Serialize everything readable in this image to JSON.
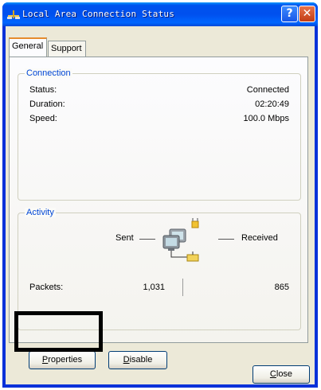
{
  "window": {
    "title": "Local Area Connection Status"
  },
  "title_buttons": {
    "help": "?",
    "close": "✕"
  },
  "tabs": [
    {
      "label": "General",
      "active": true
    },
    {
      "label": "Support",
      "active": false
    }
  ],
  "connection": {
    "group_label": "Connection",
    "rows": [
      {
        "label": "Status:",
        "value": "Connected"
      },
      {
        "label": "Duration:",
        "value": "02:20:49"
      },
      {
        "label": "Speed:",
        "value": "100.0 Mbps"
      }
    ]
  },
  "activity": {
    "group_label": "Activity",
    "sent_label": "Sent",
    "received_label": "Received",
    "packets_label": "Packets:",
    "packets_sent": "1,031",
    "packets_received": "865"
  },
  "buttons": {
    "properties_prefix": "",
    "properties_mnemonic": "P",
    "properties_rest": "roperties",
    "disable_mnemonic": "D",
    "disable_rest": "isable",
    "close_mnemonic": "C",
    "close_rest": "lose"
  },
  "colors": {
    "titlebar": "#0053ee",
    "group_label": "#0046d5",
    "dialog_bg": "#ece9d8",
    "tab_accent": "#e68b2c"
  }
}
